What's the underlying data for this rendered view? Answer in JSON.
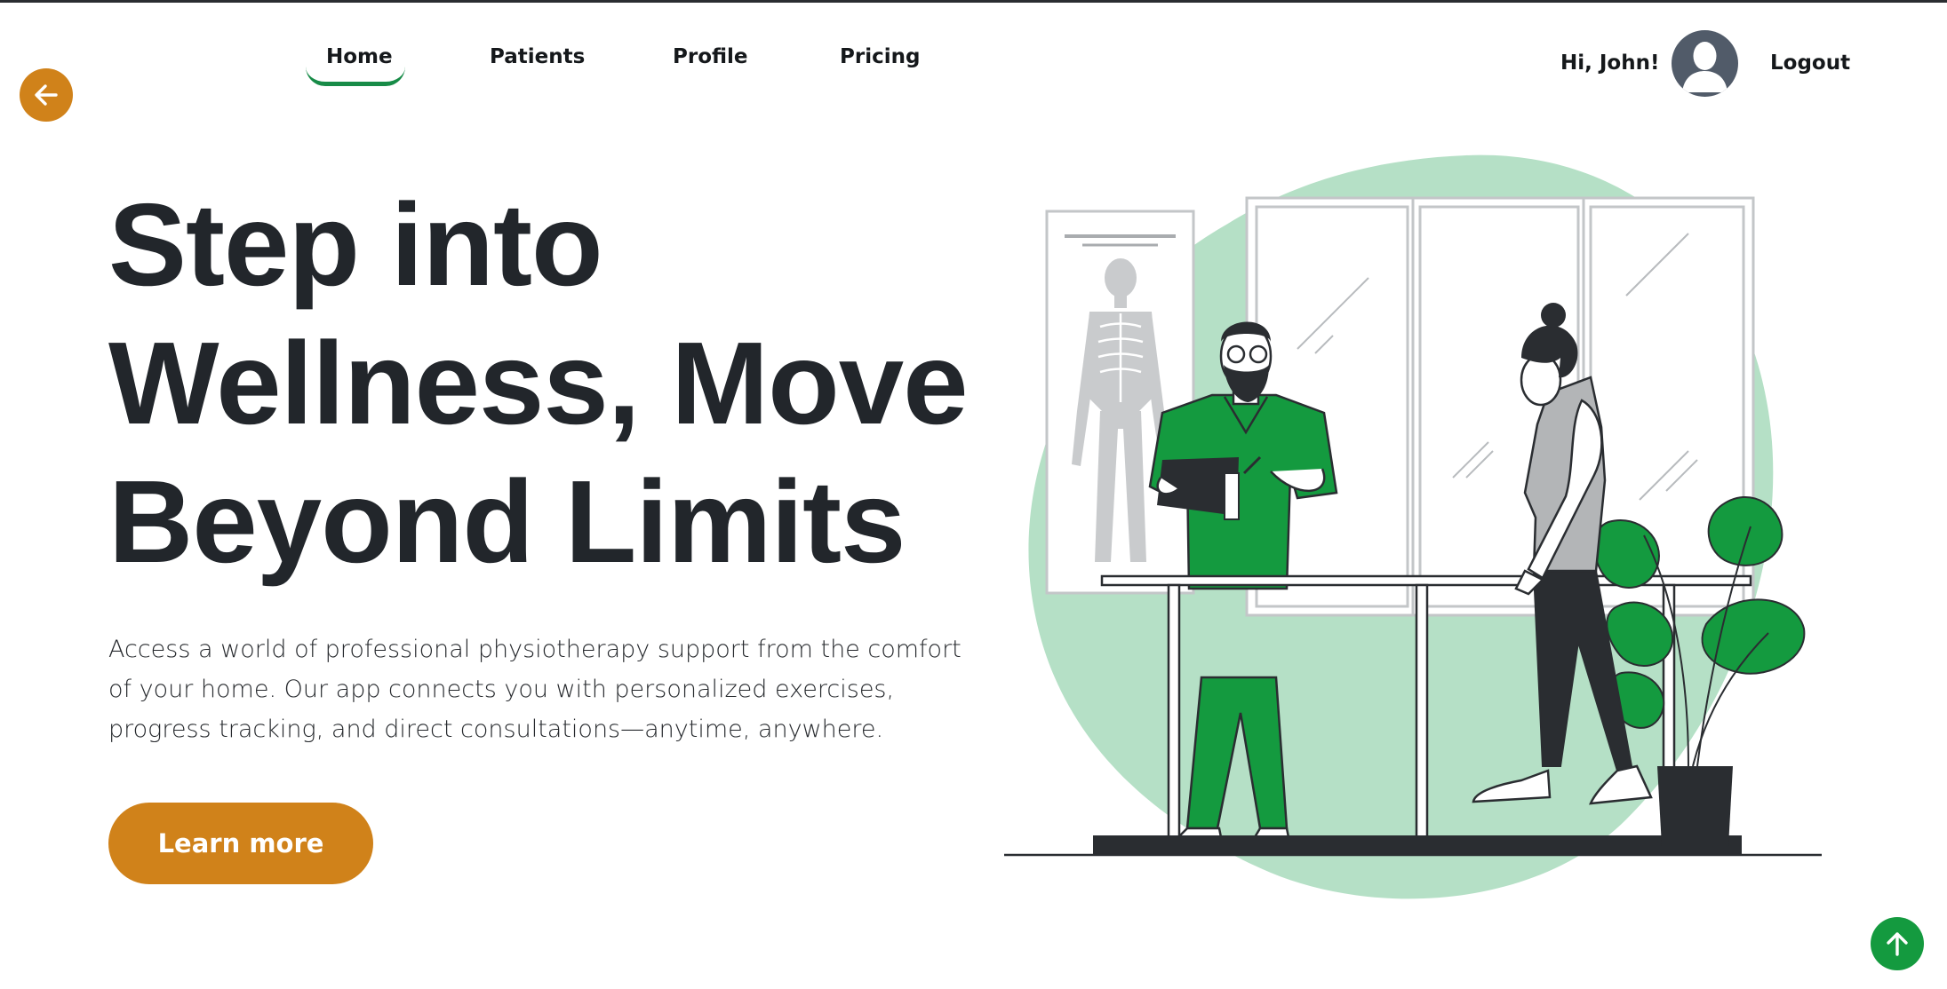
{
  "nav": {
    "items": [
      {
        "label": "Home",
        "active": true
      },
      {
        "label": "Patients",
        "active": false
      },
      {
        "label": "Profile",
        "active": false
      },
      {
        "label": "Pricing",
        "active": false
      }
    ]
  },
  "user": {
    "greeting": "Hi, John!",
    "logout_label": "Logout"
  },
  "hero": {
    "title_lines": [
      "Step into",
      "Wellness, Move",
      "Beyond Limits"
    ],
    "description": "Access a world of professional physiotherapy support from the comfort of your home. Our app connects you with personalized exercises, progress tracking, and direct consultations—anytime, anywhere.",
    "cta_label": "Learn more"
  },
  "icons": {
    "back": "arrow-left-icon",
    "scroll_top": "arrow-up-icon",
    "avatar": "user-avatar-icon"
  },
  "colors": {
    "accent_orange": "#d0821a",
    "accent_green": "#178b47",
    "scrub_green": "#149a3f",
    "blob_green": "#b5e0c6",
    "text_dark": "#22262b"
  }
}
